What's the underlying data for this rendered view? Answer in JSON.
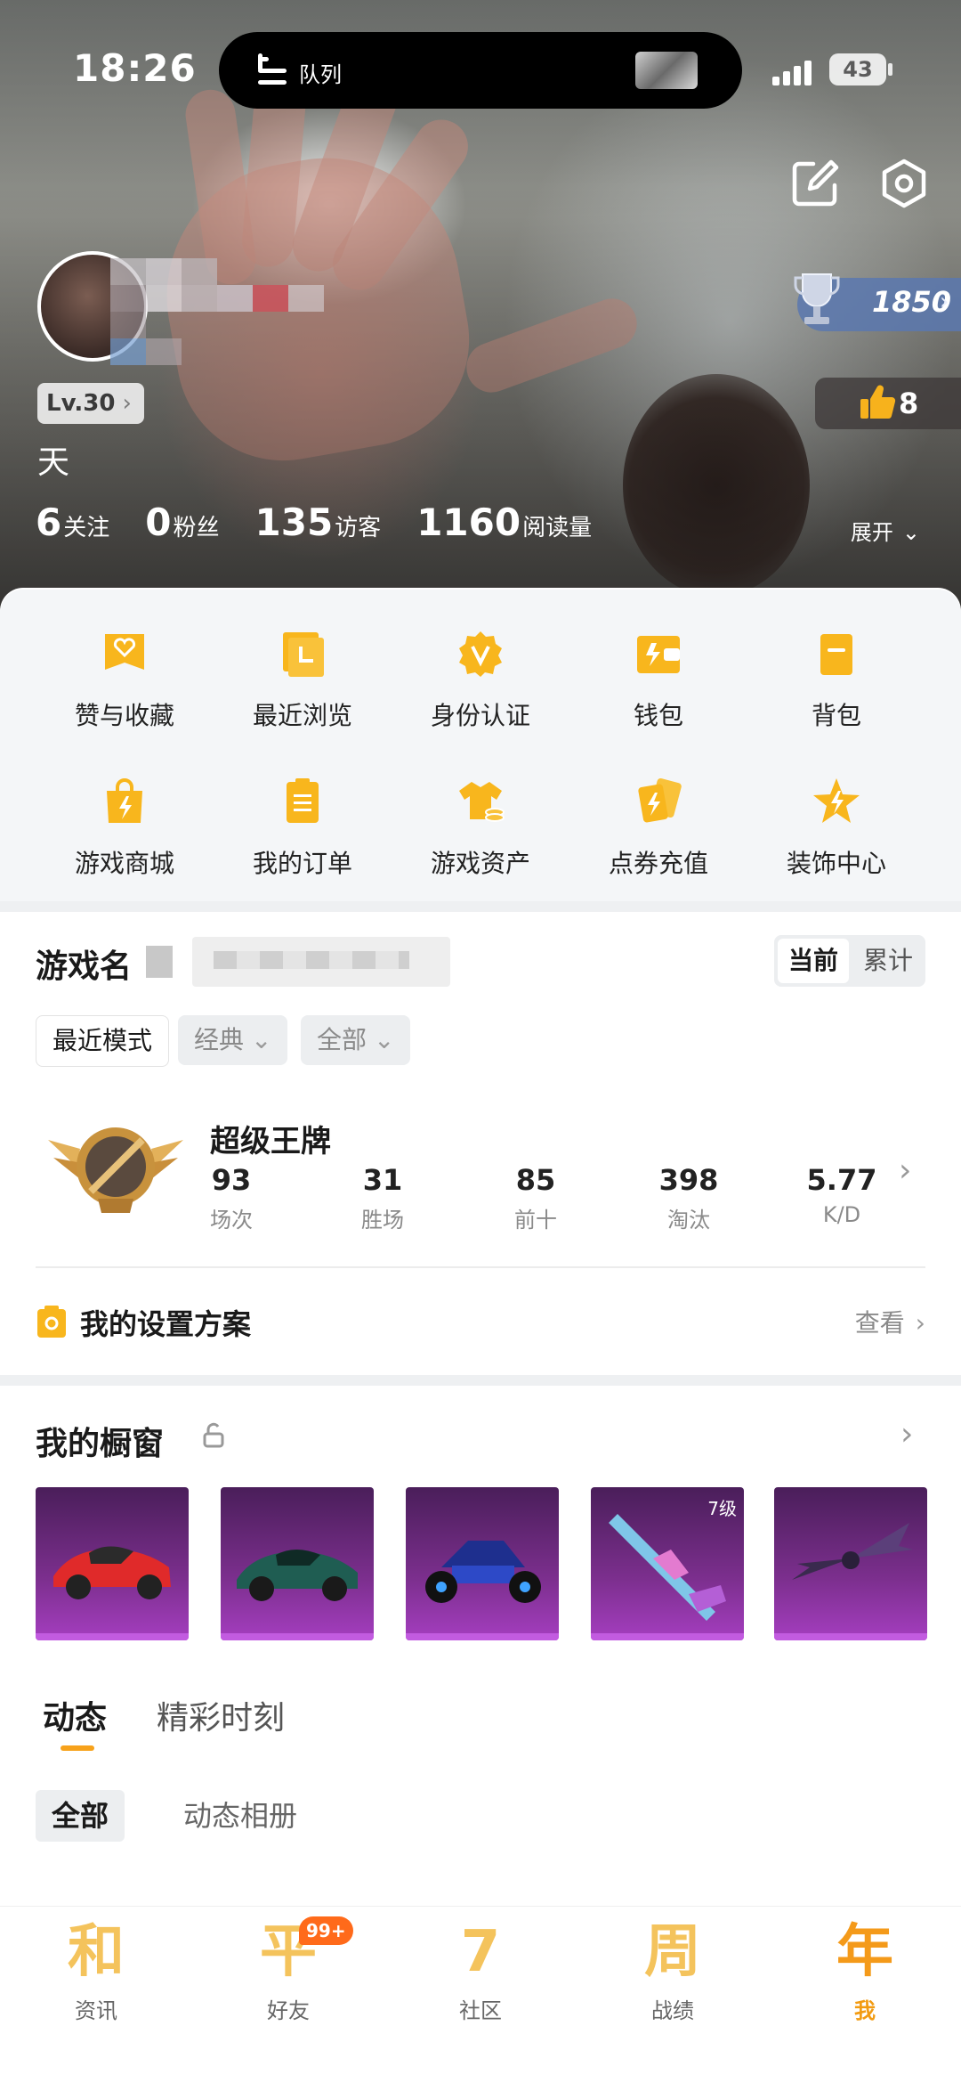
{
  "status_bar": {
    "time": "18:26",
    "island_text": "队列",
    "battery": "43"
  },
  "profile": {
    "level": "Lv.30",
    "nickname": "天",
    "trophy_score": "1850",
    "likes": "8",
    "stats": [
      {
        "value": "6",
        "label": "关注"
      },
      {
        "value": "0",
        "label": "粉丝"
      },
      {
        "value": "135",
        "label": "访客"
      },
      {
        "value": "1160",
        "label": "阅读量"
      }
    ],
    "expand_label": "展开"
  },
  "quick_menu": [
    {
      "label": "赞与收藏",
      "icon": "heart-folder-icon"
    },
    {
      "label": "最近浏览",
      "icon": "recent-folder-icon"
    },
    {
      "label": "身份认证",
      "icon": "verify-badge-icon"
    },
    {
      "label": "钱包",
      "icon": "wallet-icon"
    },
    {
      "label": "背包",
      "icon": "backpack-icon"
    },
    {
      "label": "游戏商城",
      "icon": "shop-bag-icon"
    },
    {
      "label": "我的订单",
      "icon": "clipboard-icon"
    },
    {
      "label": "游戏资产",
      "icon": "shirt-coins-icon"
    },
    {
      "label": "点券充值",
      "icon": "coupon-cards-icon"
    },
    {
      "label": "装饰中心",
      "icon": "star-bolt-icon"
    }
  ],
  "game": {
    "title": "游戏名",
    "toggle": [
      "当前",
      "累计"
    ],
    "filters": {
      "mode": "最近模式",
      "type": "经典",
      "scope": "全部"
    },
    "rank": {
      "name": "超级王牌",
      "stats": [
        {
          "value": "93",
          "label": "场次"
        },
        {
          "value": "31",
          "label": "胜场"
        },
        {
          "value": "85",
          "label": "前十"
        },
        {
          "value": "398",
          "label": "淘汰"
        },
        {
          "value": "5.77",
          "label": "K/D"
        }
      ]
    },
    "settings": {
      "title": "我的设置方案",
      "link": "查看"
    }
  },
  "showcase": {
    "title": "我的橱窗",
    "items": [
      {
        "name": "red-sports-car"
      },
      {
        "name": "green-sports-car"
      },
      {
        "name": "buggy-car"
      },
      {
        "name": "skin-rifle",
        "badge": "7级"
      },
      {
        "name": "winged-glider"
      }
    ]
  },
  "feed": {
    "tabs": [
      "动态",
      "精彩时刻"
    ],
    "subtabs": [
      "全部",
      "动态相册"
    ]
  },
  "bottom_nav": {
    "items": [
      {
        "glyph": "和",
        "label": "资讯"
      },
      {
        "glyph": "平",
        "label": "好友"
      },
      {
        "glyph": "7",
        "label": "社区"
      },
      {
        "glyph": "周",
        "label": "战绩"
      },
      {
        "glyph": "年",
        "label": "我"
      }
    ],
    "friends_badge": "99+"
  },
  "colors": {
    "accent": "#f7a21b",
    "icon_yellow": "#f8b61d",
    "card_purple": "#7c2f8e"
  }
}
